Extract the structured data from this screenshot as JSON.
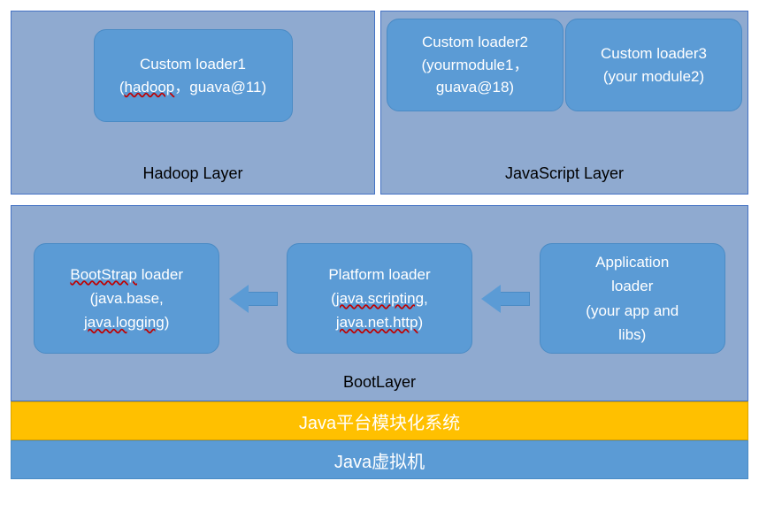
{
  "hadoopLayer": {
    "label": "Hadoop Layer",
    "module": {
      "title": "Custom loader1",
      "detail_prefix": "(",
      "detail_u1": "hadoop",
      "detail_mid": "，guava@11)",
      "detail_suffix": ""
    }
  },
  "jsLayer": {
    "label": "JavaScript Layer",
    "module1": {
      "title": "Custom loader2",
      "line2": "(yourmodule1，",
      "line3": "guava@18)"
    },
    "module2": {
      "title": "Custom loader3",
      "line2": "(your module2)"
    }
  },
  "bootLayer": {
    "label": "BootLayer",
    "bootstrap": {
      "title_u": "BootStrap",
      "title_rest": " loader",
      "line2": "(java.base,",
      "line3_u": "java.logging",
      "line3_rest": ")"
    },
    "platform": {
      "title": "Platform loader",
      "line2_prefix": "(",
      "line2_u": "java.scripting",
      "line2_suffix": ",",
      "line3_u": "java.net.http",
      "line3_rest": ")"
    },
    "application": {
      "line1": "Application",
      "line2": "loader",
      "line3": "(your app and",
      "line4": "libs)"
    }
  },
  "platformBar": "Java平台模块化系统",
  "jvmBar": "Java虚拟机"
}
